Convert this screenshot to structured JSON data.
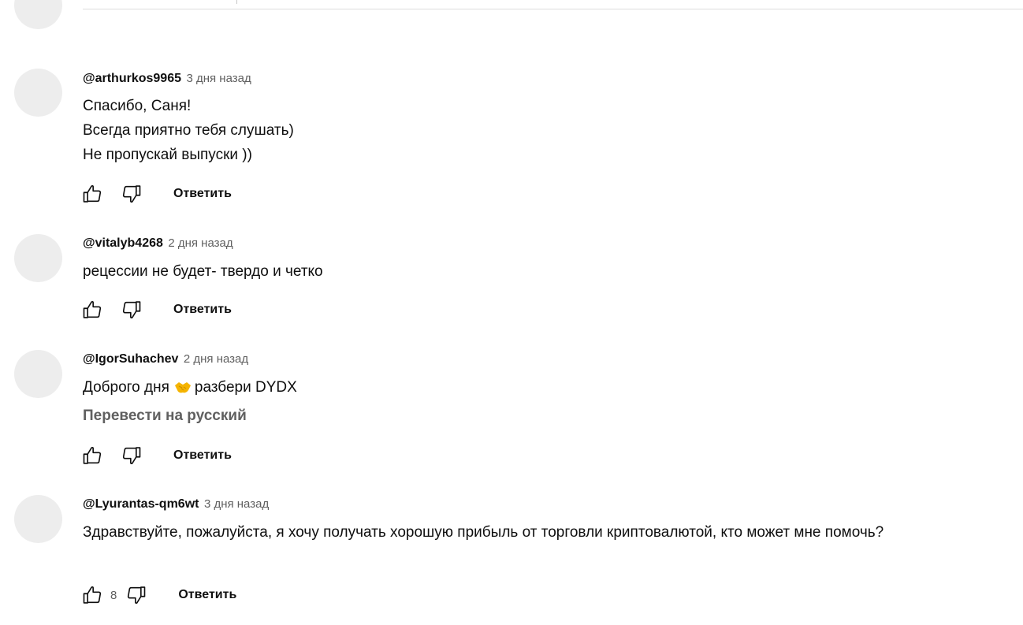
{
  "comments": [
    {
      "author": "@arthurkos9965",
      "time": "3 дня назад",
      "lines": [
        "Спасибо, Саня!",
        "Всегда приятно тебя слушать)",
        "Не пропускай выпуски ))"
      ],
      "reply_label": "Ответить"
    },
    {
      "author": "@vitalyb4268",
      "time": "2 дня назад",
      "lines": [
        "рецессии не будет- твердо и четко"
      ],
      "reply_label": "Ответить"
    },
    {
      "author": "@IgorSuhachev",
      "time": "2 дня назад",
      "text_before_emoji": "Доброго дня",
      "emoji": "handshake-emoji",
      "text_after_emoji": "разбери DYDX",
      "translate_label": "Перевести на русский",
      "reply_label": "Ответить"
    },
    {
      "author": "@Lyurantas-qm6wt",
      "time": "3 дня назад",
      "text": "Здравствуйте, пожалуйста, я хочу получать хорошую прибыль от торговли криптовалютой, кто может мне помочь?",
      "likes": "8",
      "reply_label": "Ответить"
    }
  ],
  "icons": {
    "like": "thumb-up-icon",
    "dislike": "thumb-down-icon"
  }
}
